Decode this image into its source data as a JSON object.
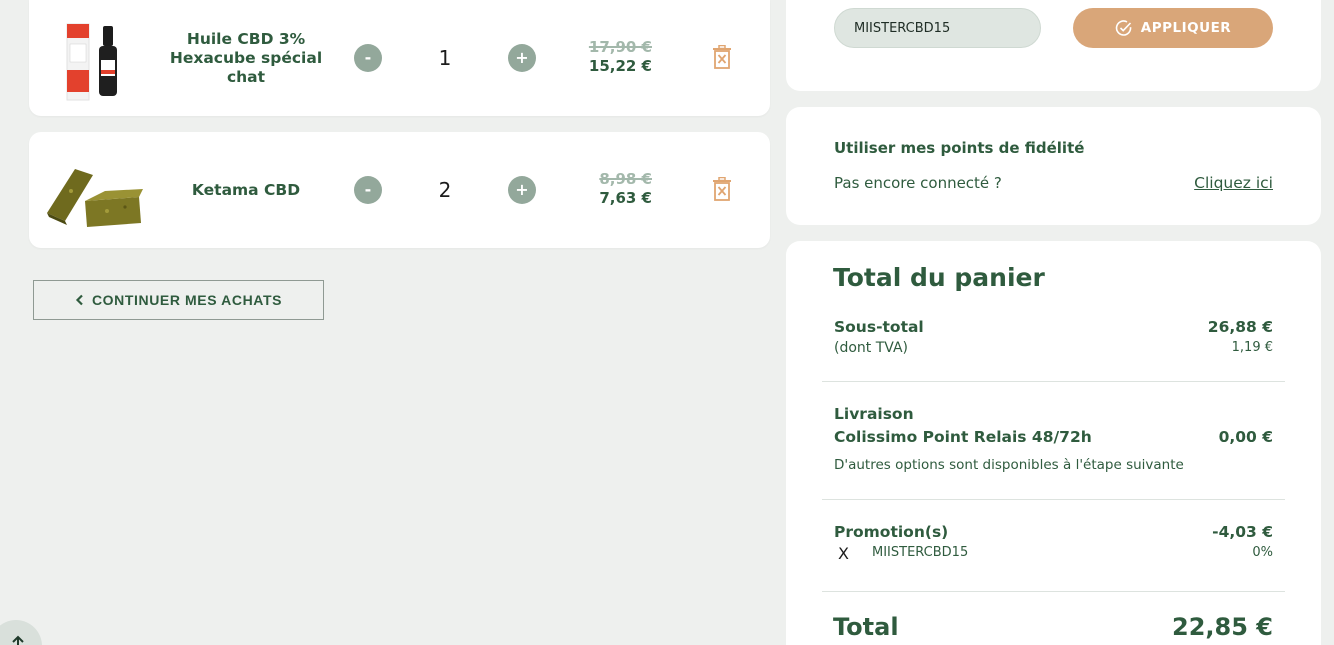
{
  "cart": {
    "items": [
      {
        "name": "Huile CBD 3% Hexacube spécial chat",
        "quantity": "1",
        "price_old": "17,90 €",
        "price_new": "15,22 €"
      },
      {
        "name": "Ketama CBD",
        "quantity": "2",
        "price_old": "8,98 €",
        "price_new": "7,63 €"
      }
    ],
    "minus_label": "-",
    "plus_label": "+",
    "continue_label": "CONTINUER MES ACHATS"
  },
  "promo": {
    "code_value": "MIISTERCBD15",
    "apply_label": "APPLIQUER"
  },
  "loyalty": {
    "title": "Utiliser mes points de fidélité",
    "text": "Pas encore connecté ?",
    "link": "Cliquez ici"
  },
  "totals": {
    "title": "Total du panier",
    "subtotal_label": "Sous-total",
    "subtotal_value": "26,88 €",
    "tax_label": "(dont TVA)",
    "tax_value": "1,19 €",
    "shipping_label": "Livraison",
    "shipping_method": "Colissimo Point Relais 48/72h",
    "shipping_value": "0,00 €",
    "shipping_note": "D'autres options sont disponibles à l'étape suivante",
    "promo_label": "Promotion(s)",
    "promo_value": "-4,03 €",
    "promo_remove": "X",
    "promo_code": "MIISTERCBD15",
    "promo_percent": "0%",
    "grand_label": "Total",
    "grand_value": "22,85 €"
  },
  "colors": {
    "brand_green": "#2f5b3e",
    "accent_tan": "#d9a679",
    "trash_orange": "#e0a571",
    "background": "#eef0ee"
  },
  "icons": {
    "trash": "trash-x-icon",
    "check": "check-circle-icon",
    "chevron": "chevron-left-icon",
    "arrow_up": "arrow-up-icon"
  }
}
